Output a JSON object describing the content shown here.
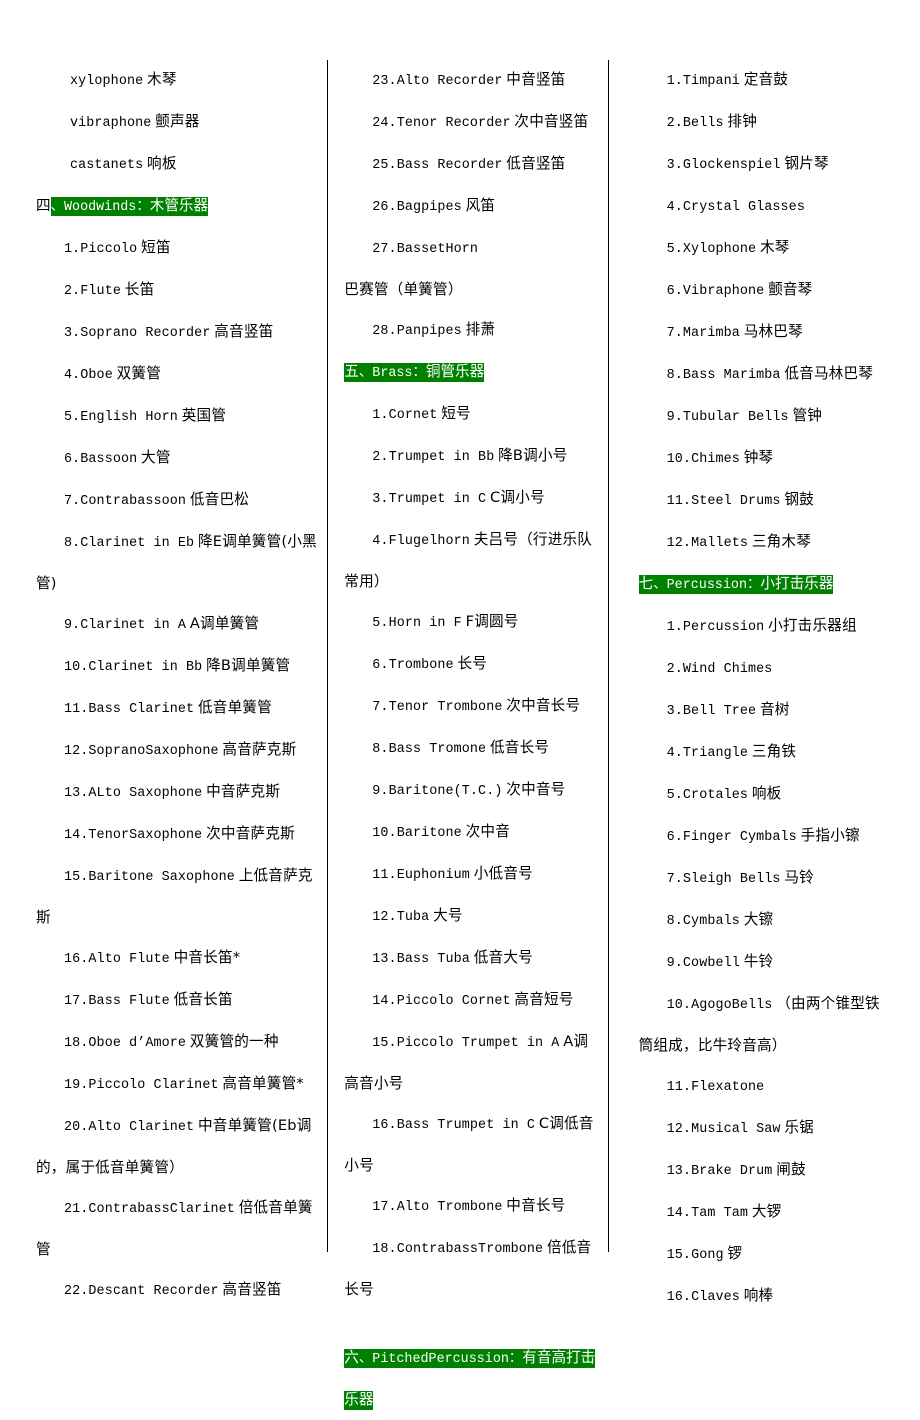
{
  "document": {
    "type": "instrument-name-list",
    "language": "en-zh",
    "highlight_color": "#008000",
    "highlight_text_color": "#ffffff",
    "column_count": 3
  },
  "columns": [
    {
      "id": "column-1",
      "blocks": [
        {
          "kind": "entry",
          "en": "xylophone",
          "cn": "木琴",
          "num": ""
        },
        {
          "kind": "entry",
          "en": "vibraphone",
          "cn": "颤声器",
          "num": ""
        },
        {
          "kind": "entry",
          "en": "castanets",
          "cn": "响板",
          "num": ""
        },
        {
          "kind": "header",
          "prefix": "四",
          "en": "、Woodwinds：",
          "cn": "木管乐器",
          "prefix_highlighted": false
        },
        {
          "kind": "entry",
          "num": "1.",
          "en": "Piccolo",
          "cn": "短笛"
        },
        {
          "kind": "entry",
          "num": "2.",
          "en": "Flute",
          "cn": "长笛"
        },
        {
          "kind": "entry",
          "num": "3.",
          "en": "Soprano Recorder",
          "cn": "高音竖笛"
        },
        {
          "kind": "entry",
          "num": "4.",
          "en": "Oboe",
          "cn": "双簧管"
        },
        {
          "kind": "entry",
          "num": "5.",
          "en": "English Horn",
          "cn": "英国管"
        },
        {
          "kind": "entry",
          "num": "6.",
          "en": "Bassoon",
          "cn": "大管"
        },
        {
          "kind": "entry",
          "num": "7.",
          "en": "Contrabassoon",
          "cn": "低音巴松"
        },
        {
          "kind": "entry",
          "num": "8.",
          "en": "Clarinet in Eb",
          "cn": "降E调单簧管(小黑管)"
        },
        {
          "kind": "entry",
          "num": "9.",
          "en": "Clarinet in A",
          "cn": "A调单簧管"
        },
        {
          "kind": "entry",
          "num": "10.",
          "en": "Clarinet in Bb",
          "cn": "降B调单簧管"
        },
        {
          "kind": "entry",
          "num": "11.",
          "en": "Bass Clarinet",
          "cn": "低音单簧管"
        },
        {
          "kind": "entry",
          "num": "12.",
          "en": "SopranoSaxophone",
          "cn": "高音萨克斯"
        },
        {
          "kind": "entry",
          "num": "13.",
          "en": "ALto Saxophone",
          "cn": "中音萨克斯"
        },
        {
          "kind": "entry",
          "num": "14.",
          "en": "TenorSaxophone",
          "cn": "次中音萨克斯"
        },
        {
          "kind": "entry",
          "num": "15.",
          "en": "Baritone Saxophone",
          "cn": "上低音萨克斯"
        },
        {
          "kind": "entry",
          "num": "16.",
          "en": "Alto Flute",
          "cn": "中音长笛*"
        },
        {
          "kind": "entry",
          "num": "17.",
          "en": "Bass Flute",
          "cn": "低音长笛"
        },
        {
          "kind": "entry",
          "num": "18.",
          "en": "Oboe d’Amore",
          "cn": "双簧管的一种"
        },
        {
          "kind": "entry",
          "num": "19.",
          "en": "Piccolo Clarinet",
          "cn": "高音单簧管*"
        },
        {
          "kind": "entry",
          "num": "20.",
          "en": "Alto Clarinet",
          "cn": "中音单簧管(Eb调的，属于低音单簧管）"
        },
        {
          "kind": "entry",
          "num": "21.",
          "en": "ContrabassClarinet",
          "cn": "倍低音单簧管"
        },
        {
          "kind": "entry",
          "num": "22.",
          "en": "Descant Recorder",
          "cn": "高音竖笛"
        }
      ]
    },
    {
      "id": "column-2",
      "blocks": [
        {
          "kind": "entry",
          "num": "23.",
          "en": "Alto Recorder",
          "cn": "中音竖笛"
        },
        {
          "kind": "entry",
          "num": "24.",
          "en": "Tenor Recorder",
          "cn": "次中音竖笛"
        },
        {
          "kind": "entry",
          "num": "25.",
          "en": "Bass Recorder",
          "cn": "低音竖笛"
        },
        {
          "kind": "entry",
          "num": "26.",
          "en": "Bagpipes",
          "cn": "风笛"
        },
        {
          "kind": "entry",
          "num": "27.",
          "en": "BassetHorn",
          "cn": "巴赛管（单簧管）"
        },
        {
          "kind": "entry",
          "num": "28.",
          "en": "Panpipes",
          "cn": "排萧"
        },
        {
          "kind": "header",
          "prefix": "五",
          "en": "、Brass：",
          "cn": "铜管乐器",
          "prefix_highlighted": true
        },
        {
          "kind": "entry",
          "num": "1.",
          "en": "Cornet",
          "cn": "短号"
        },
        {
          "kind": "entry",
          "num": "2.",
          "en": "Trumpet in Bb",
          "cn": "降B调小号"
        },
        {
          "kind": "entry",
          "num": "3.",
          "en": "Trumpet in C",
          "cn": "C调小号"
        },
        {
          "kind": "entry",
          "num": "4.",
          "en": "Flugelhorn",
          "cn": "夫吕号（行进乐队常用）"
        },
        {
          "kind": "entry",
          "num": "5.",
          "en": "Horn in F",
          "cn": "F调圆号"
        },
        {
          "kind": "entry",
          "num": "6.",
          "en": "Trombone",
          "cn": "长号"
        },
        {
          "kind": "entry",
          "num": "7.",
          "en": "Tenor Trombone",
          "cn": "次中音长号"
        },
        {
          "kind": "entry",
          "num": "8.",
          "en": "Bass Tromone",
          "cn": "低音长号"
        },
        {
          "kind": "entry",
          "num": "9.",
          "en": "Baritone(T.C.)",
          "cn": "次中音号"
        },
        {
          "kind": "entry",
          "num": "10.",
          "en": "Baritone",
          "cn": "次中音"
        },
        {
          "kind": "entry",
          "num": "11.",
          "en": "Euphonium",
          "cn": "小低音号"
        },
        {
          "kind": "entry",
          "num": "12.",
          "en": "Tuba",
          "cn": "大号"
        },
        {
          "kind": "entry",
          "num": "13.",
          "en": "Bass Tuba",
          "cn": "低音大号"
        },
        {
          "kind": "entry",
          "num": "14.",
          "en": "Piccolo Cornet",
          "cn": "高音短号"
        },
        {
          "kind": "entry",
          "num": "15.",
          "en": "Piccolo Trumpet in A",
          "cn": "A调高音小号"
        },
        {
          "kind": "entry",
          "num": "16.",
          "en": "Bass Trumpet in C",
          "cn": "C调低音小号"
        },
        {
          "kind": "entry",
          "num": "17.",
          "en": "Alto Trombone",
          "cn": "中音长号"
        },
        {
          "kind": "entry",
          "num": "18.",
          "en": "ContrabassTrombone",
          "cn": "倍低音长号"
        },
        {
          "kind": "spacer"
        },
        {
          "kind": "header",
          "prefix": "六",
          "en": "、PitchedPercussion：",
          "cn": "有音高打击乐器",
          "prefix_highlighted": true
        }
      ]
    },
    {
      "id": "column-3",
      "blocks": [
        {
          "kind": "entry",
          "num": "1.",
          "en": "Timpani",
          "cn": "定音鼓"
        },
        {
          "kind": "entry",
          "num": "2.",
          "en": "Bells",
          "cn": "排钟"
        },
        {
          "kind": "entry",
          "num": "3.",
          "en": "Glockenspiel",
          "cn": "钢片琴"
        },
        {
          "kind": "entry",
          "num": "4.",
          "en": "Crystal Glasses",
          "cn": ""
        },
        {
          "kind": "entry",
          "num": "5.",
          "en": "Xylophone",
          "cn": "木琴"
        },
        {
          "kind": "entry",
          "num": "6.",
          "en": "Vibraphone",
          "cn": "颤音琴"
        },
        {
          "kind": "entry",
          "num": "7.",
          "en": "Marimba",
          "cn": "马林巴琴"
        },
        {
          "kind": "entry",
          "num": "8.",
          "en": "Bass Marimba",
          "cn": "低音马林巴琴"
        },
        {
          "kind": "entry",
          "num": "9.",
          "en": "Tubular Bells",
          "cn": "管钟"
        },
        {
          "kind": "entry",
          "num": "10.",
          "en": "Chimes",
          "cn": "钟琴"
        },
        {
          "kind": "entry",
          "num": "11.",
          "en": "Steel Drums",
          "cn": "钢鼓"
        },
        {
          "kind": "entry",
          "num": "12.",
          "en": "Mallets",
          "cn": "三角木琴"
        },
        {
          "kind": "header",
          "prefix": "七",
          "en": "、Percussion：",
          "cn": "小打击乐器",
          "prefix_highlighted": true
        },
        {
          "kind": "entry",
          "num": "1.",
          "en": "Percussion",
          "cn": "小打击乐器组"
        },
        {
          "kind": "entry",
          "num": "2.",
          "en": "Wind Chimes",
          "cn": ""
        },
        {
          "kind": "entry",
          "num": "3.",
          "en": "Bell Tree",
          "cn": "音树"
        },
        {
          "kind": "entry",
          "num": "4.",
          "en": "Triangle",
          "cn": "三角铁"
        },
        {
          "kind": "entry",
          "num": "5.",
          "en": "Crotales",
          "cn": "响板"
        },
        {
          "kind": "entry",
          "num": "6.",
          "en": "Finger Cymbals",
          "cn": "手指小镲"
        },
        {
          "kind": "entry",
          "num": "7.",
          "en": "Sleigh Bells",
          "cn": "马铃"
        },
        {
          "kind": "entry",
          "num": "8.",
          "en": "Cymbals",
          "cn": "大镲"
        },
        {
          "kind": "entry",
          "num": "9.",
          "en": "Cowbell",
          "cn": "牛铃"
        },
        {
          "kind": "entry",
          "num": "10.",
          "en": "AgogoBells",
          "cn": "（由两个锥型铁筒组成，比牛玲音高）"
        },
        {
          "kind": "entry",
          "num": "11.",
          "en": "Flexatone",
          "cn": ""
        },
        {
          "kind": "entry",
          "num": "12.",
          "en": "Musical Saw",
          "cn": "乐锯"
        },
        {
          "kind": "entry",
          "num": "13.",
          "en": "Brake Drum",
          "cn": "闸鼓"
        },
        {
          "kind": "entry",
          "num": "14.",
          "en": "Tam Tam",
          "cn": "大锣"
        },
        {
          "kind": "entry",
          "num": "15.",
          "en": "Gong",
          "cn": "锣"
        },
        {
          "kind": "entry",
          "num": "16.",
          "en": "Claves",
          "cn": "响棒"
        }
      ]
    }
  ]
}
